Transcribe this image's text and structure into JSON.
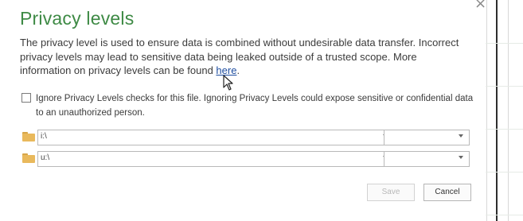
{
  "dialog": {
    "title": "Privacy levels",
    "description": "The privacy level is used to ensure data is combined without undesirable data transfer. Incorrect privacy levels may lead to sensitive data being leaked outside of a trusted scope. More information on privacy levels can be found ",
    "link_text": "here",
    "description_end": ".",
    "close_glyph": "×"
  },
  "ignore_checkbox": {
    "checked": false,
    "label": "Ignore Privacy Levels checks for this file. Ignoring Privacy Levels could expose sensitive or confidential data to an unauthorized person."
  },
  "sources": [
    {
      "icon": "folder-icon",
      "path": "i:\\",
      "privacy_level": ""
    },
    {
      "icon": "folder-icon",
      "path": "u:\\",
      "privacy_level": ""
    }
  ],
  "buttons": {
    "save": "Save",
    "save_enabled": false,
    "cancel": "Cancel"
  },
  "colors": {
    "title": "#3e8a45",
    "link": "#1f4ea0",
    "folder": "#e9b95c"
  }
}
